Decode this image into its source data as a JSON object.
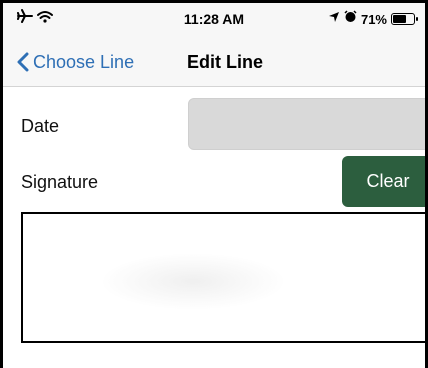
{
  "status_bar": {
    "time": "11:28 AM",
    "battery_percent": "71%",
    "battery_level": 0.71,
    "left_icons": [
      "airplane-icon",
      "wifi-icon"
    ],
    "right_icons": [
      "location-arrow-icon",
      "alarm-icon",
      "battery-icon"
    ]
  },
  "nav": {
    "back_label": "Choose Line",
    "title": "Edit Line",
    "accent_color": "#2e6fb5"
  },
  "form": {
    "date_label": "Date",
    "date_value": "",
    "signature_label": "Signature",
    "clear_label": "Clear",
    "clear_button_color": "#2c5e3e"
  }
}
